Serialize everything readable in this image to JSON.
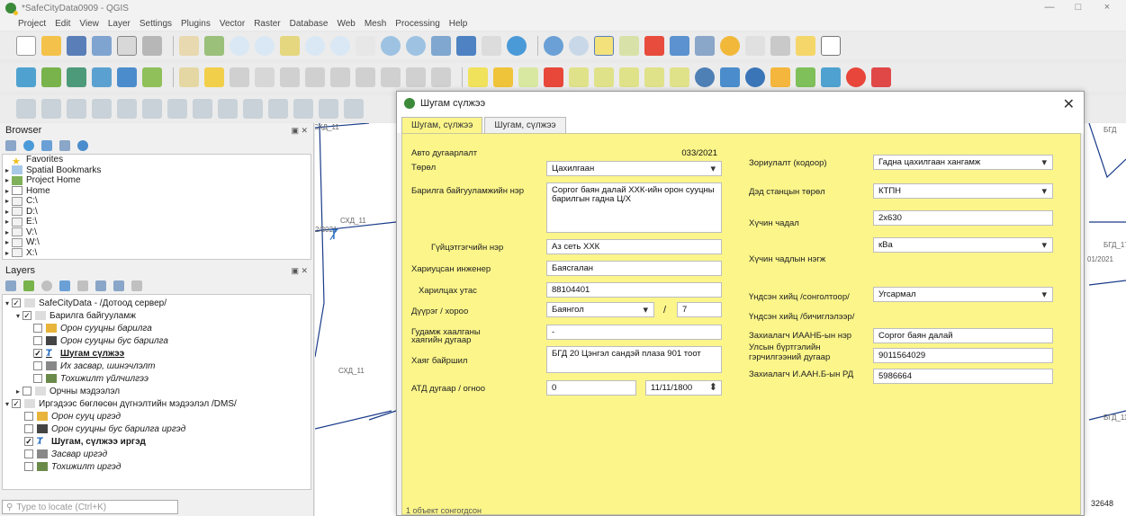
{
  "window": {
    "title": "*SafeCityData0909 - QGIS",
    "controls": [
      "—",
      "□",
      "×"
    ]
  },
  "menu": [
    "Project",
    "Edit",
    "View",
    "Layer",
    "Settings",
    "Plugins",
    "Vector",
    "Raster",
    "Database",
    "Web",
    "Mesh",
    "Processing",
    "Help"
  ],
  "browser": {
    "title": "Browser",
    "items": [
      {
        "label": "Favorites",
        "icon": "star-icon"
      },
      {
        "label": "Spatial Bookmarks",
        "icon": "bookmark-icon"
      },
      {
        "label": "Project Home",
        "icon": "folder-icon"
      },
      {
        "label": "Home",
        "icon": "home-icon"
      },
      {
        "label": "C:\\",
        "icon": "drive-icon"
      },
      {
        "label": "D:\\",
        "icon": "drive-icon"
      },
      {
        "label": "E:\\",
        "icon": "drive-icon"
      },
      {
        "label": "V:\\",
        "icon": "drive-icon"
      },
      {
        "label": "W:\\",
        "icon": "drive-icon"
      },
      {
        "label": "X:\\",
        "icon": "drive-icon"
      }
    ]
  },
  "layers": {
    "title": "Layers",
    "items": [
      {
        "label": "SafeCityData - /Дотоод сервер/",
        "style": "normal"
      },
      {
        "label": "Барилга байгууламж",
        "style": "normal"
      },
      {
        "label": "Орон сууцны барилга",
        "style": "italic"
      },
      {
        "label": "Орон сууцны бус барилга",
        "style": "italic"
      },
      {
        "label": "Шугам сүлжээ",
        "style": "bold-ul"
      },
      {
        "label": "Их засвар, шинэчлэлт",
        "style": "italic"
      },
      {
        "label": "Тохижилт үйлчилгээ",
        "style": "italic"
      },
      {
        "label": "Орчны мэдээлэл",
        "style": "normal"
      },
      {
        "label": "Иргэдээс бөглөсөн дүгнэлтийн мэдээлэл /DMS/",
        "style": "normal"
      },
      {
        "label": "Орон сууц иргэд",
        "style": "italic"
      },
      {
        "label": "Орон сууцны бус барилга иргэд",
        "style": "italic"
      },
      {
        "label": "Шугам, сүлжээ иргэд",
        "style": "bold"
      },
      {
        "label": "Засвар иргэд",
        "style": "italic"
      },
      {
        "label": "Тохижилт иргэд",
        "style": "italic"
      }
    ],
    "locate_placeholder": "Type to locate (Ctrl+K)"
  },
  "map": {
    "labels": [
      "СХД_11",
      "СХД_11",
      "2/2021",
      "БГД_17",
      "01/2021",
      "БГД_11",
      "БГД",
      "32648"
    ]
  },
  "dialog": {
    "title": "Шугам сүлжээ",
    "tabs": [
      "Шугам, сүлжээ",
      "Шугам, сүлжээ"
    ],
    "fields": {
      "auto_number": {
        "label": "Авто дугаарлалт",
        "value": "033/2021"
      },
      "type": {
        "label": "Төрөл",
        "value": "Цахилгаан"
      },
      "building_name": {
        "label": "Барилга байгууламжийн нэр",
        "value": "Соргог баян далай ХХК-ийн орон сууцны барилгын гадна Ц/Х"
      },
      "contractor": {
        "label": "Гүйцэтгэгчийн нэр",
        "value": "Аз сеть ХХК"
      },
      "engineer": {
        "label": "Хариуцсан инженер",
        "value": "Баясгалан"
      },
      "phone": {
        "label": "Харилцах утас",
        "value": "88104401"
      },
      "district": {
        "label": "Дүүрэг / хороо",
        "value": "Баянгол",
        "khoroo": "7",
        "slash": "/"
      },
      "street": {
        "label": "Гудамж хаалганы хаягийн дугаар",
        "value": "-"
      },
      "address": {
        "label": "Хаяг байршил",
        "value": "БГД 20 Цэнгэл сандэй плаза 901 тоот"
      },
      "atd": {
        "label": "АТД дугаар / огноо",
        "value": "0",
        "date": "11/11/1800"
      },
      "purpose": {
        "label": "Зориулалт (кодоор)",
        "value": "Гадна цахилгаан хангамж"
      },
      "substation_type": {
        "label": "Дэд станцын төрөл",
        "value": "КТПН"
      },
      "capacity": {
        "label": "Хүчин чадал",
        "value": "2x630"
      },
      "capacity_unit": {
        "label": "Хүчин чадлын нэгж",
        "value": "кВа"
      },
      "source_select": {
        "label": "Үндсэн хийц /сонголтоор/",
        "value": "Угсармал"
      },
      "source_text": {
        "label": "Үндсэн хийц /бичиглэлээр/"
      },
      "client_name": {
        "label": "Захиалагч ИААНБ-ын нэр",
        "value": "Соргог баян далай"
      },
      "state_reg": {
        "label": "Улсын бүртгэлийн гэрчилгээний дугаар",
        "value": "9011564029"
      },
      "client_rd": {
        "label": "Захиалагч И.ААН.Б-ын РД",
        "value": "5986664"
      }
    },
    "status_text": "1 объект сонгогдсон"
  }
}
